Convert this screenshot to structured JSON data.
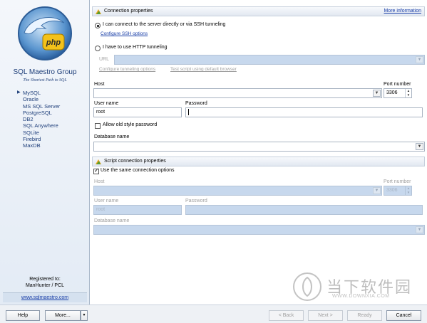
{
  "sidebar": {
    "brand_title": "SQL Maestro Group",
    "brand_subtitle": "The Shortest Path to SQL",
    "logo_text": "php",
    "databases": [
      "MySQL",
      "Oracle",
      "MS SQL Server",
      "PostgreSQL",
      "DB2",
      "SQL Anywhere",
      "SQLite",
      "Firebird",
      "MaxDB"
    ],
    "active_database": "MySQL",
    "registered_label": "Registered to:",
    "registered_user": "ManHunter / PCL",
    "website": "www.sqlmaestro.com"
  },
  "connection": {
    "header": "Connection properties",
    "more_info": "More information",
    "option_direct": "I can connect to the server directly or via SSH tunneling",
    "configure_ssh": "Configure SSH options",
    "option_http": "I have to use HTTP tunneling",
    "url_label": "URL",
    "configure_tunneling": "Configure tunneling options",
    "test_script": "Test script using default browser",
    "host_label": "Host",
    "host_value": "",
    "port_label": "Port number",
    "port_value": "3306",
    "username_label": "User name",
    "username_value": "root",
    "password_label": "Password",
    "password_value": "",
    "old_password_label": "Allow old style password",
    "database_label": "Database name",
    "database_value": ""
  },
  "script": {
    "header": "Script connection properties",
    "same_options_label": "Use the same connection options",
    "host_label": "Host",
    "port_label": "Port number",
    "port_value": "3306",
    "username_label": "User name",
    "username_value": "root",
    "password_label": "Password",
    "database_label": "Database name"
  },
  "buttons": {
    "help": "Help",
    "more": "More...",
    "back": "< Back",
    "next": "Next >",
    "ready": "Ready",
    "cancel": "Cancel"
  },
  "watermark": {
    "text": "当下软件园",
    "sub": "WWW.DOWNXIA.COM"
  },
  "colors": {
    "brand": "#1f3f7a",
    "link": "#1a3fa8",
    "disabled_field": "#c7d8ed"
  }
}
